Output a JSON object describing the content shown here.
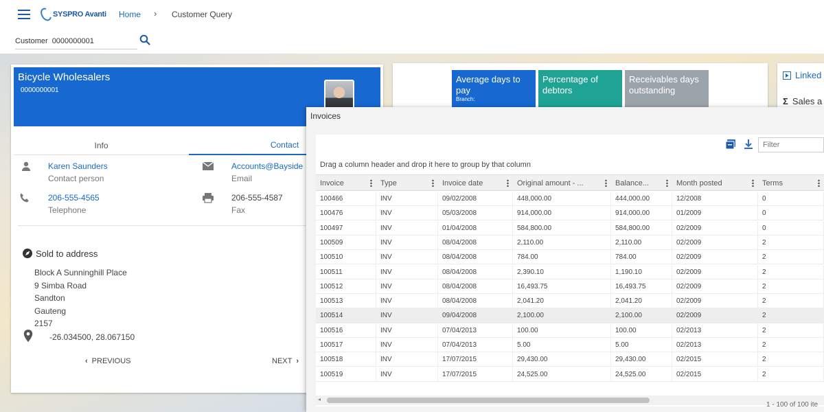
{
  "header": {
    "logo_text": "SYSPRO Avanti",
    "breadcrumb_home": "Home",
    "breadcrumb_separator": "›",
    "breadcrumb_current": "Customer Query"
  },
  "customer_search": {
    "label": "Customer",
    "value": "0000000001"
  },
  "customer": {
    "name": "Bicycle Wholesalers",
    "code": "0000000001",
    "tabs": [
      "Info",
      "Contact"
    ],
    "active_tab": "Contact",
    "contact_name": "Karen Saunders",
    "contact_name_label": "Contact person",
    "telephone": "206-555-4565",
    "telephone_label": "Telephone",
    "email": "Accounts@Bayside",
    "email_label": "Email",
    "fax": "206-555-4587",
    "fax_label": "Fax",
    "sold_to_title": "Sold to address",
    "address_lines": [
      "Block A Sunninghill Place",
      "9 Simba Road",
      "Sandton",
      "Gauteng",
      "2157"
    ],
    "geolocation": "-26.034500, 28.067150",
    "prev_label": "PREVIOUS",
    "next_label": "NEXT"
  },
  "kpis": [
    {
      "label": "Average days to pay",
      "sub": "Branch:",
      "color": "#1769d1"
    },
    {
      "label": "Percentage of debtors",
      "color": "#1fa394"
    },
    {
      "label": "Receivables days outstanding",
      "color": "#9ba4ab"
    }
  ],
  "side_links": {
    "linked": "Linked",
    "sales": "Sales a"
  },
  "invoices": {
    "title": "Invoices",
    "filter_placeholder": "Filter",
    "group_hint": "Drag a column header and drop it here to group by that column",
    "columns": [
      "Invoice",
      "Type",
      "Invoice date",
      "Original amount - ...",
      "Balance...",
      "Month posted",
      "Terms"
    ],
    "rows": [
      [
        "100466",
        "INV",
        "09/02/2008",
        "448,000.00",
        "444,000.00",
        "12/2008",
        "0"
      ],
      [
        "100476",
        "INV",
        "05/03/2008",
        "914,000.00",
        "914,000.00",
        "01/2009",
        "0"
      ],
      [
        "100497",
        "INV",
        "01/04/2008",
        "584,800.00",
        "584,800.00",
        "02/2009",
        "0"
      ],
      [
        "100509",
        "INV",
        "08/04/2008",
        "2,110.00",
        "2,110.00",
        "02/2009",
        "2"
      ],
      [
        "100510",
        "INV",
        "08/04/2008",
        "784.00",
        "784.00",
        "02/2009",
        "2"
      ],
      [
        "100511",
        "INV",
        "08/04/2008",
        "2,390.10",
        "1,190.10",
        "02/2009",
        "2"
      ],
      [
        "100512",
        "INV",
        "08/04/2008",
        "16,493.75",
        "16,493.75",
        "02/2009",
        "2"
      ],
      [
        "100513",
        "INV",
        "08/04/2008",
        "2,041.20",
        "2,041.20",
        "02/2009",
        "2"
      ],
      [
        "100514",
        "INV",
        "09/04/2008",
        "2,100.00",
        "2,100.00",
        "02/2009",
        "2"
      ],
      [
        "100516",
        "INV",
        "07/04/2013",
        "100.00",
        "100.00",
        "02/2013",
        "2"
      ],
      [
        "100517",
        "INV",
        "07/04/2013",
        "5.00",
        "5.00",
        "02/2013",
        "2"
      ],
      [
        "100518",
        "INV",
        "17/07/2015",
        "29,430.00",
        "29,430.00",
        "02/2015",
        "2"
      ],
      [
        "100519",
        "INV",
        "17/07/2015",
        "24,525.00",
        "24,525.00",
        "02/2015",
        "2"
      ]
    ],
    "highlighted_row": 8,
    "pager_text": "1 - 100 of 100 ite"
  }
}
